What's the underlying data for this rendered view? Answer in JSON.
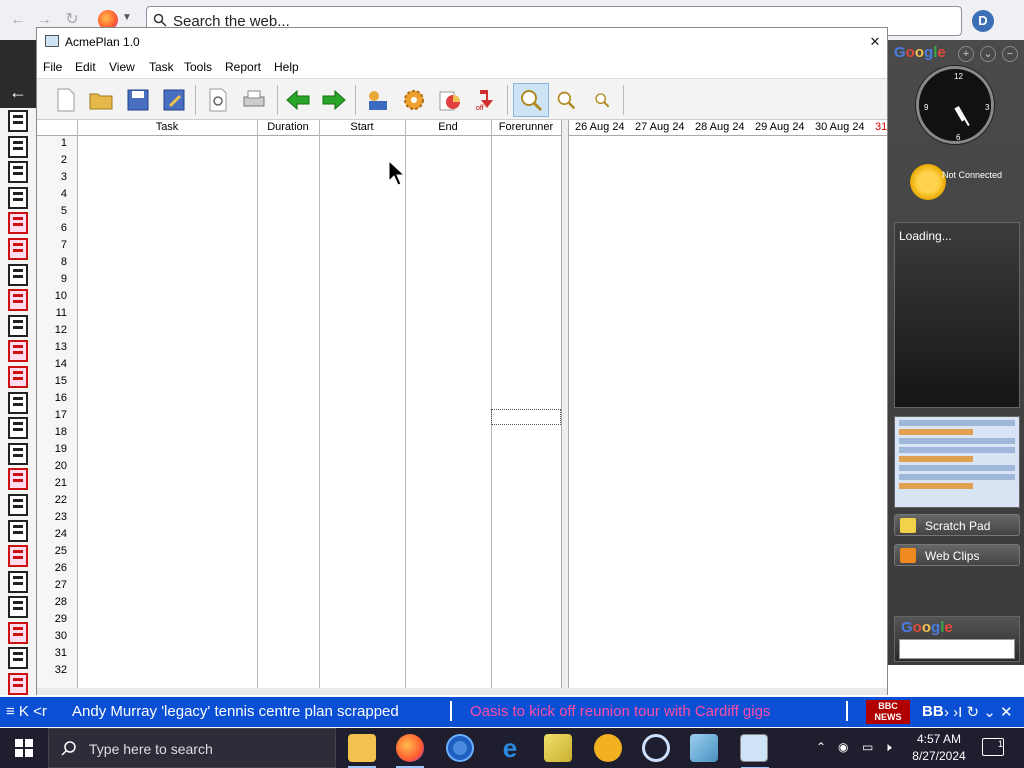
{
  "browser": {
    "search_placeholder": "Search the web...",
    "extension_letter": "D"
  },
  "app": {
    "title": "AcmePlan 1.0",
    "menu": [
      "File",
      "Edit",
      "View",
      "Task",
      "Tools",
      "Report",
      "Help"
    ],
    "toolbar_icons": [
      "new-file-icon",
      "open-folder-icon",
      "save-icon",
      "edit-save-icon",
      "print-preview-icon",
      "print-icon",
      "back-arrow-icon",
      "forward-arrow-icon",
      "resources-icon",
      "settings-gear-icon",
      "chart-icon",
      "off-arrow-icon",
      "zoom-icon",
      "zoom-in-icon",
      "zoom-out-icon"
    ],
    "grid": {
      "columns": [
        "Task",
        "Duration",
        "Start",
        "End",
        "Forerunner"
      ],
      "rows": [
        "1",
        "2",
        "3",
        "4",
        "5",
        "6",
        "7",
        "8",
        "9",
        "10",
        "11",
        "12",
        "13",
        "14",
        "15",
        "16",
        "17",
        "18",
        "19",
        "20",
        "21",
        "22",
        "23",
        "24",
        "25",
        "26",
        "27",
        "28",
        "29",
        "30",
        "31",
        "32"
      ]
    },
    "gantt": {
      "dates": [
        "26 Aug 24",
        "27 Aug 24",
        "28 Aug 24",
        "29 Aug 24",
        "30 Aug 24",
        "31"
      ],
      "weekend_color": "#e00000"
    }
  },
  "gadgets": {
    "weather_status": "Not Connected",
    "loading_label": "Loading...",
    "scratch_pad": "Scratch Pad",
    "web_clips": "Web Clips"
  },
  "ticker": {
    "items": [
      "Andy Murray 'legacy' tennis centre plan scrapped",
      "Oasis to kick off reunion tour with Cardiff gigs"
    ],
    "news_logo_top": "BBC",
    "news_logo_bottom": "NEWS",
    "trailing": "BB"
  },
  "taskbar": {
    "search_placeholder": "Type here to search",
    "time": "4:57 AM",
    "date": "8/27/2024",
    "notification_count": "1"
  }
}
